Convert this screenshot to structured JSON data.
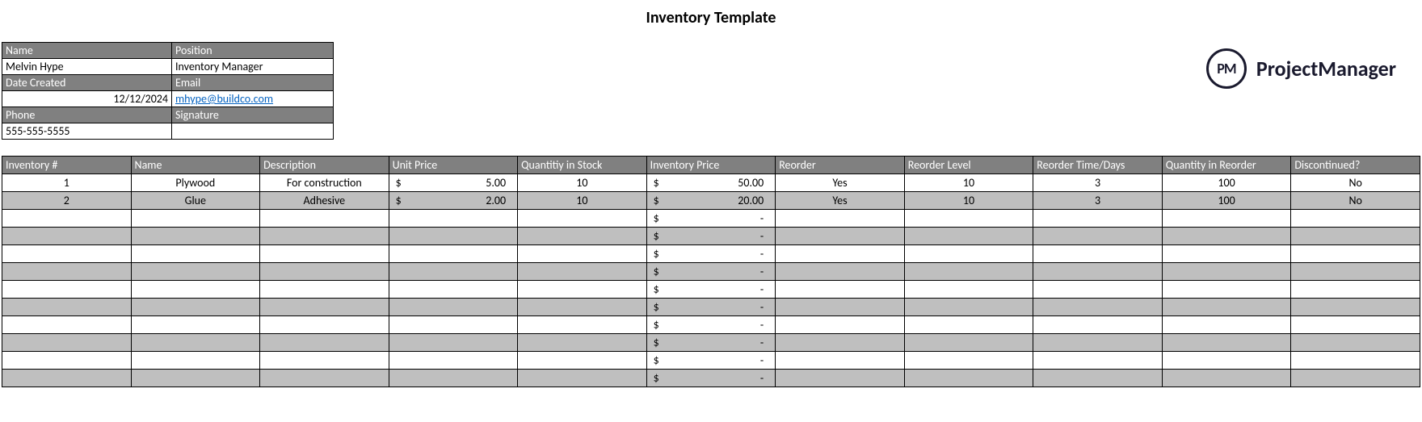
{
  "title": "Inventory Template",
  "logo": {
    "abbr": "PM",
    "text": "ProjectManager"
  },
  "info": {
    "name_label": "Name",
    "name_value": "Melvin Hype",
    "position_label": "Position",
    "position_value": "Inventory Manager",
    "date_label": "Date Created",
    "date_value": "12/12/2024",
    "email_label": "Email",
    "email_value": "mhype@buildco.com",
    "phone_label": "Phone",
    "phone_value": "555-555-5555",
    "signature_label": "Signature",
    "signature_value": ""
  },
  "columns": {
    "inv": "Inventory #",
    "name": "Name",
    "desc": "Description",
    "unit": "Unit Price",
    "qis": "Quantitiy in Stock",
    "ip": "Inventory Price",
    "reo": "Reorder",
    "rl": "Reorder Level",
    "rtd": "Reorder Time/Days",
    "qir": "Quantity in Reorder",
    "disc": "Discontinued?"
  },
  "rows": [
    {
      "inv": "1",
      "name": "Plywood",
      "desc": "For construction",
      "unit_sym": "$",
      "unit_val": "5.00",
      "qis": "10",
      "ip_sym": "$",
      "ip_val": "50.00",
      "reo": "Yes",
      "rl": "10",
      "rtd": "3",
      "qir": "100",
      "disc": "No",
      "shade": "white"
    },
    {
      "inv": "2",
      "name": "Glue",
      "desc": "Adhesive",
      "unit_sym": "$",
      "unit_val": "2.00",
      "qis": "10",
      "ip_sym": "$",
      "ip_val": "20.00",
      "reo": "Yes",
      "rl": "10",
      "rtd": "3",
      "qir": "100",
      "disc": "No",
      "shade": "grey"
    },
    {
      "inv": "",
      "name": "",
      "desc": "",
      "unit_sym": "",
      "unit_val": "",
      "qis": "",
      "ip_sym": "$",
      "ip_val": "-",
      "reo": "",
      "rl": "",
      "rtd": "",
      "qir": "",
      "disc": "",
      "shade": "white"
    },
    {
      "inv": "",
      "name": "",
      "desc": "",
      "unit_sym": "",
      "unit_val": "",
      "qis": "",
      "ip_sym": "$",
      "ip_val": "-",
      "reo": "",
      "rl": "",
      "rtd": "",
      "qir": "",
      "disc": "",
      "shade": "grey"
    },
    {
      "inv": "",
      "name": "",
      "desc": "",
      "unit_sym": "",
      "unit_val": "",
      "qis": "",
      "ip_sym": "$",
      "ip_val": "-",
      "reo": "",
      "rl": "",
      "rtd": "",
      "qir": "",
      "disc": "",
      "shade": "white"
    },
    {
      "inv": "",
      "name": "",
      "desc": "",
      "unit_sym": "",
      "unit_val": "",
      "qis": "",
      "ip_sym": "$",
      "ip_val": "-",
      "reo": "",
      "rl": "",
      "rtd": "",
      "qir": "",
      "disc": "",
      "shade": "grey"
    },
    {
      "inv": "",
      "name": "",
      "desc": "",
      "unit_sym": "",
      "unit_val": "",
      "qis": "",
      "ip_sym": "$",
      "ip_val": "-",
      "reo": "",
      "rl": "",
      "rtd": "",
      "qir": "",
      "disc": "",
      "shade": "white"
    },
    {
      "inv": "",
      "name": "",
      "desc": "",
      "unit_sym": "",
      "unit_val": "",
      "qis": "",
      "ip_sym": "$",
      "ip_val": "-",
      "reo": "",
      "rl": "",
      "rtd": "",
      "qir": "",
      "disc": "",
      "shade": "grey"
    },
    {
      "inv": "",
      "name": "",
      "desc": "",
      "unit_sym": "",
      "unit_val": "",
      "qis": "",
      "ip_sym": "$",
      "ip_val": "-",
      "reo": "",
      "rl": "",
      "rtd": "",
      "qir": "",
      "disc": "",
      "shade": "white"
    },
    {
      "inv": "",
      "name": "",
      "desc": "",
      "unit_sym": "",
      "unit_val": "",
      "qis": "",
      "ip_sym": "$",
      "ip_val": "-",
      "reo": "",
      "rl": "",
      "rtd": "",
      "qir": "",
      "disc": "",
      "shade": "grey"
    },
    {
      "inv": "",
      "name": "",
      "desc": "",
      "unit_sym": "",
      "unit_val": "",
      "qis": "",
      "ip_sym": "$",
      "ip_val": "-",
      "reo": "",
      "rl": "",
      "rtd": "",
      "qir": "",
      "disc": "",
      "shade": "white"
    },
    {
      "inv": "",
      "name": "",
      "desc": "",
      "unit_sym": "",
      "unit_val": "",
      "qis": "",
      "ip_sym": "$",
      "ip_val": "-",
      "reo": "",
      "rl": "",
      "rtd": "",
      "qir": "",
      "disc": "",
      "shade": "grey"
    }
  ]
}
